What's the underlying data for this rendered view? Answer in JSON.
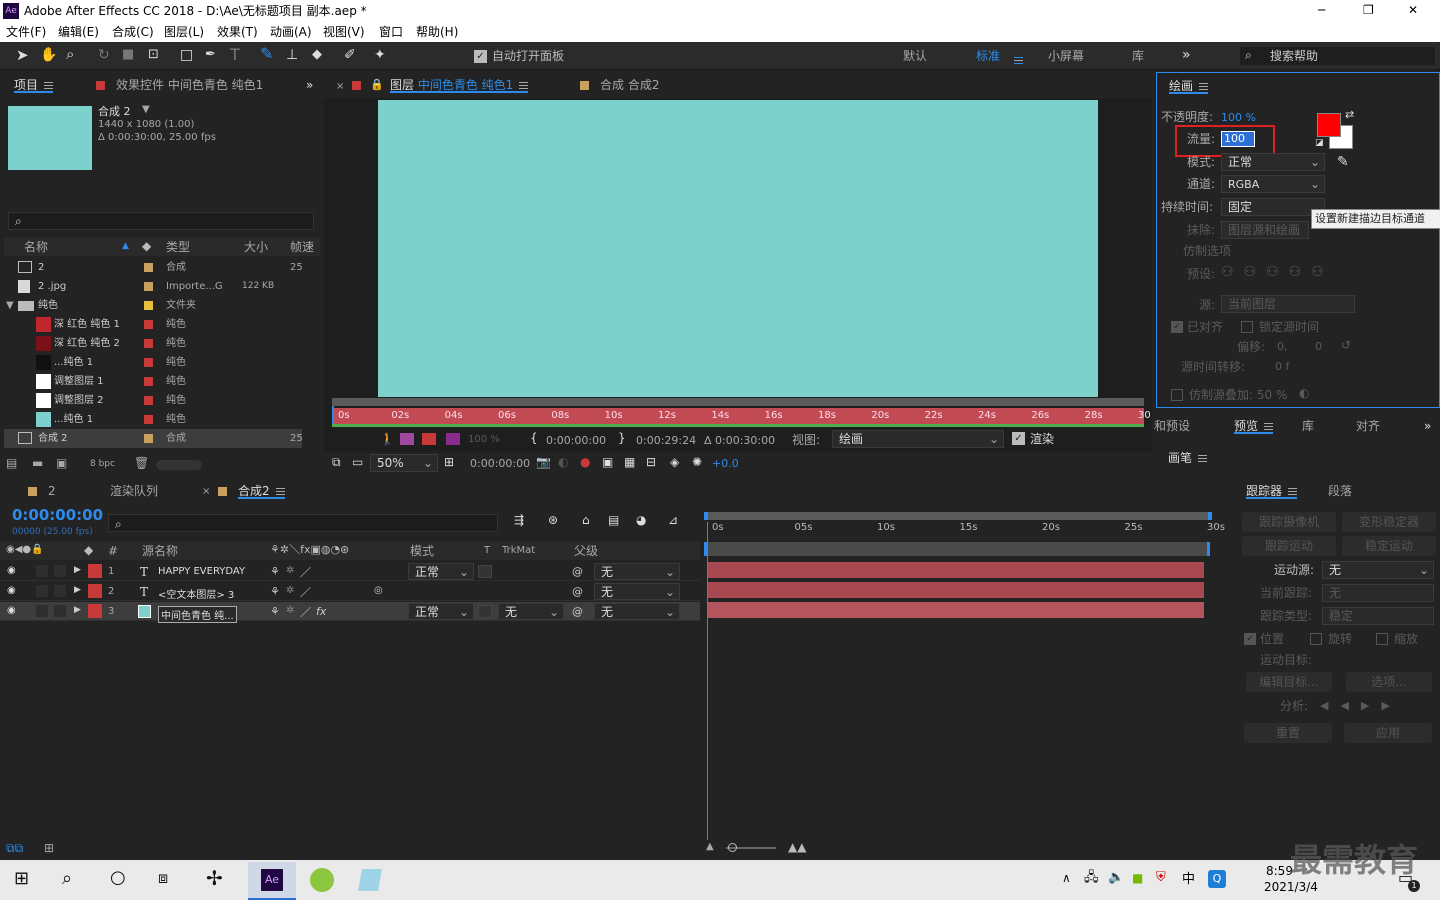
{
  "window": {
    "title": "Adobe After Effects CC 2018 - D:\\Ae\\无标题项目 副本.aep *",
    "min": "─",
    "max": "❐",
    "close": "✕"
  },
  "menu": [
    "文件(F)",
    "编辑(E)",
    "合成(C)",
    "图层(L)",
    "效果(T)",
    "动画(A)",
    "视图(V)",
    "窗口",
    "帮助(H)"
  ],
  "toolbar": {
    "auto_open": "自动打开面板",
    "workspaces": [
      "默认",
      "标准",
      "小屏幕",
      "库"
    ],
    "search_placeholder": "搜索帮助",
    "more": "»"
  },
  "project": {
    "tab": "项目",
    "effects_tab": "效果控件 中间色青色 纯色1",
    "comp_name": "合成 2",
    "meta1": "1440 x 1080 (1.00)",
    "meta2": "Δ 0:00:30:00, 25.00 fps",
    "search_icon": "⌕",
    "headers": [
      "名称",
      "类型",
      "大小",
      "帧速"
    ],
    "rows": [
      {
        "name": "2",
        "type": "合成",
        "size": "",
        "fps": "25",
        "color": "#c8a060"
      },
      {
        "name": "2 .jpg",
        "type": "Importe...G",
        "size": "122 KB",
        "fps": "",
        "color": "#c8a060"
      },
      {
        "name": "纯色",
        "type": "文件夹",
        "size": "",
        "fps": "",
        "color": "#e8c040"
      },
      {
        "name": "深 红色 纯色 1",
        "type": "纯色",
        "size": "",
        "fps": "",
        "color": "#c83a3a"
      },
      {
        "name": "深 红色 纯色 2",
        "type": "纯色",
        "size": "",
        "fps": "",
        "color": "#c83a3a"
      },
      {
        "name": "...纯色 1",
        "type": "纯色",
        "size": "",
        "fps": "",
        "color": "#c83a3a"
      },
      {
        "name": "调整图层 1",
        "type": "纯色",
        "size": "",
        "fps": "",
        "color": "#c83a3a"
      },
      {
        "name": "调整图层 2",
        "type": "纯色",
        "size": "",
        "fps": "",
        "color": "#c83a3a"
      },
      {
        "name": "...纯色 1",
        "type": "纯色",
        "size": "",
        "fps": "",
        "color": "#c83a3a"
      },
      {
        "name": "合成 2",
        "type": "合成",
        "size": "",
        "fps": "25",
        "color": "#c8a060"
      }
    ],
    "bpc": "8 bpc"
  },
  "viewer": {
    "layer_tab_prefix": "图层",
    "layer_tab_name": "中间色青色 纯色1",
    "comp_tab": "合成 合成2",
    "ticks": [
      "0s",
      "02s",
      "04s",
      "06s",
      "08s",
      "10s",
      "12s",
      "14s",
      "16s",
      "18s",
      "20s",
      "22s",
      "24s",
      "26s",
      "28s",
      "30"
    ],
    "opacity": "100 %",
    "t_in": "0:00:00:00",
    "t_out": "0:00:29:24",
    "t_dur": "Δ 0:00:30:00",
    "view_label": "视图:",
    "view_value": "绘画",
    "render": "渲染",
    "zoom": "50%",
    "time": "0:00:00:00",
    "exposure": "+0.0",
    "bg": "#7dd1cc"
  },
  "paint": {
    "tab": "绘画",
    "opacity_label": "不透明度:",
    "opacity_value": "100 %",
    "flow_label": "流量:",
    "flow_value": "100",
    "mode_label": "模式:",
    "mode_value": "正常",
    "channel_label": "通道:",
    "channel_value": "RGBA",
    "duration_label": "持续时间:",
    "duration_value": "固定",
    "tooltip": "设置新建描边目标通道",
    "erase_label": "抹除:",
    "erase_value": "图层源和绘画",
    "clone_options": "仿制选项",
    "preset_label": "预设:",
    "source_label": "源:",
    "source_value": "当前图层",
    "aligned": "已对齐",
    "lock_time": "锁定源时间",
    "offset_label": "偏移:",
    "offset_value": "0, 0",
    "time_shift_label": "源时间转移:",
    "time_shift_value": "0 f",
    "overlay": "仿制源叠加: 50 %",
    "fg": "#ff0000",
    "bgc": "#ffffff"
  },
  "mid_tabs": [
    "和预设",
    "预览",
    "库",
    "对齐"
  ],
  "brush_tab": "画笔",
  "tracker": {
    "tab": "跟踪器",
    "para_tab": "段落",
    "track_camera": "跟踪摄像机",
    "warp": "变形稳定器",
    "track_motion": "跟踪运动",
    "stabilize": "稳定运动",
    "motion_source_label": "运动源:",
    "motion_source_value": "无",
    "current_track_label": "当前跟踪:",
    "current_track_value": "无",
    "track_type_label": "跟踪类型:",
    "track_type_value": "稳定",
    "position": "位置",
    "rotation": "旋转",
    "scale": "缩放",
    "motion_target": "运动目标:",
    "edit_target": "编辑目标...",
    "options": "选项...",
    "analyze": "分析:",
    "reset": "重置",
    "apply": "应用"
  },
  "timeline": {
    "render_queue": "渲染队列",
    "tab_zero": "2",
    "comp_tab": "合成2",
    "time": "0:00:00:00",
    "frames": "00000 (25.00 fps)",
    "col_source": "源名称",
    "col_mode": "模式",
    "col_t": "T",
    "col_trk": "TrkMat",
    "col_parent": "父级",
    "layers": [
      {
        "num": "1",
        "type": "T",
        "name": "HAPPY EVERYDAY",
        "mode": "正常",
        "trk": "",
        "parent": "无"
      },
      {
        "num": "2",
        "type": "T",
        "name": "<空文本图层> 3",
        "mode": "",
        "trk": "",
        "parent": "无"
      },
      {
        "num": "3",
        "type": "",
        "name": "中间色青色 纯...",
        "mode": "正常",
        "trk": "无",
        "parent": "无"
      }
    ],
    "ticks": [
      "0s",
      "05s",
      "10s",
      "15s",
      "20s",
      "25s",
      "30s"
    ]
  },
  "taskbar": {
    "time": "8:59",
    "date": "2021/3/4",
    "ime": "中",
    "watermark": "最需教育",
    "notif": "1"
  }
}
